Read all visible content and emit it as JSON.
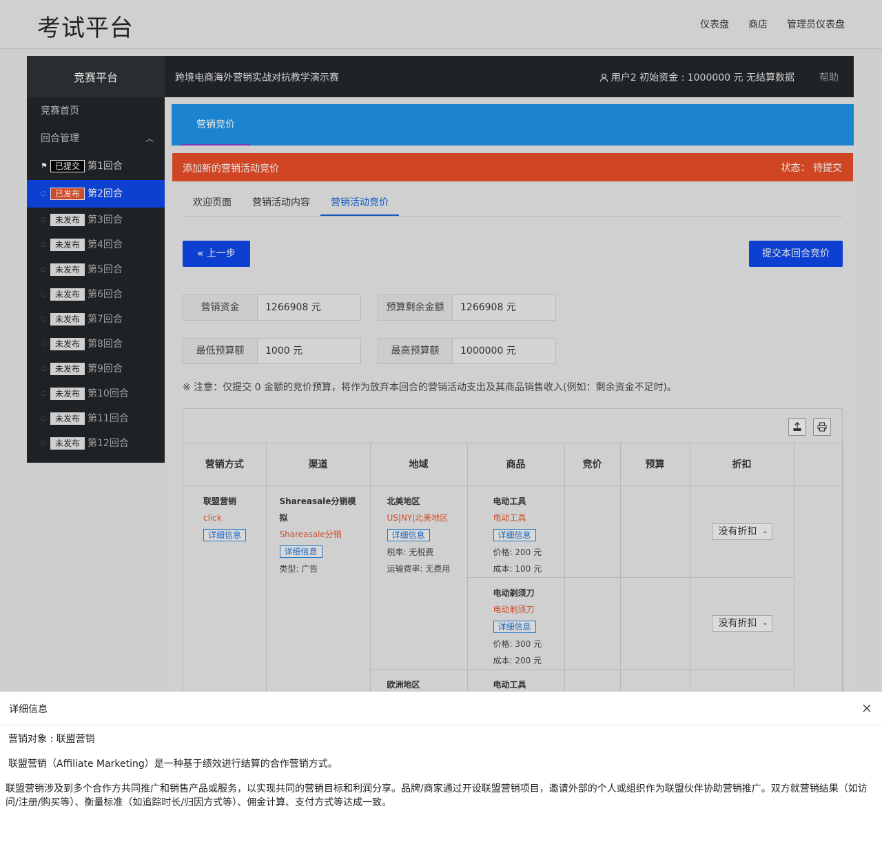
{
  "topnav": {
    "brand": "考试平台",
    "links": [
      "仪表盘",
      "商店",
      "管理员仪表盘"
    ]
  },
  "header": {
    "platform": "竞赛平台",
    "contest_title": "跨境电商海外营销实战对抗教学演示赛",
    "user_info": "用户2 初始资金 : 1000000 元 无结算数据",
    "help": "帮助"
  },
  "sidebar": {
    "home": "竞赛首页",
    "round_mgmt": "回合管理",
    "rounds": [
      {
        "status": "已提交",
        "name": "第1回合"
      },
      {
        "status": "已发布",
        "name": "第2回合"
      },
      {
        "status": "未发布",
        "name": "第3回合"
      },
      {
        "status": "未发布",
        "name": "第4回合"
      },
      {
        "status": "未发布",
        "name": "第5回合"
      },
      {
        "status": "未发布",
        "name": "第6回合"
      },
      {
        "status": "未发布",
        "name": "第7回合"
      },
      {
        "status": "未发布",
        "name": "第8回合"
      },
      {
        "status": "未发布",
        "name": "第9回合"
      },
      {
        "status": "未发布",
        "name": "第10回合"
      },
      {
        "status": "未发布",
        "name": "第11回合"
      },
      {
        "status": "未发布",
        "name": "第12回合"
      }
    ]
  },
  "tabbar": {
    "active": "营销竞价"
  },
  "panel": {
    "title": "添加新的营销活动竞价",
    "status_label": "状态：",
    "status_value": "待提交",
    "subtabs": [
      "欢迎页面",
      "营销活动内容",
      "营销活动竞价"
    ],
    "prev_button": "上一步",
    "submit_button": "提交本回合竞价",
    "fields": {
      "fund_label": "营销资金",
      "fund_value": "1266908 元",
      "remain_label": "预算剩余金额",
      "remain_value": "1266908 元",
      "min_label": "最低预算额",
      "min_value": "1000 元",
      "max_label": "最高预算额",
      "max_value": "1000000 元"
    },
    "note": "※ 注意：仅提交 0 金额的竞价预算，将作为放弃本回合的营销活动支出及其商品销售收入(例如：剩余资金不足时)。"
  },
  "table": {
    "headers": [
      "营销方式",
      "渠道",
      "地域",
      "商品",
      "竞价",
      "预算",
      "折扣"
    ],
    "method": {
      "name": "联盟营销",
      "sub": "click",
      "info": "详细信息"
    },
    "channel": {
      "name": "Shareasale分销模拟",
      "sub": "Shareasale分销",
      "info": "详细信息",
      "type": "类型: 广告"
    },
    "region1": {
      "name": "北美地区",
      "sub": "US|NY|北美地区",
      "info": "详细信息",
      "tax": "税率: 无税费",
      "ship": "运输费率: 无费用"
    },
    "region2": {
      "name": "欧洲地区"
    },
    "product1": {
      "name": "电动工具",
      "sub": "电动工具",
      "info": "详细信息",
      "price": "价格: 200 元",
      "cost": "成本: 100 元"
    },
    "product2": {
      "name": "电动剃须刀",
      "sub": "电动剃须刀",
      "info": "详细信息",
      "price": "价格: 300 元",
      "cost": "成本: 200 元"
    },
    "product3": {
      "name": "电动工具"
    },
    "discount": "没有折扣"
  },
  "modal": {
    "title": "详细信息",
    "line1": "营销对象 : 联盟营销",
    "line2": "联盟营销（Affiliate Marketing）是一种基于绩效进行结算的合作营销方式。",
    "line3": "联盟营销涉及到多个合作方共同推广和销售产品或服务，以实现共同的营销目标和利润分享。品牌/商家通过开设联盟营销项目，邀请外部的个人或组织作为联盟伙伴协助营销推广。双方就营销结果（如访问/注册/购买等）、衡量标准（如追踪时长/归因方式等）、佣金计算、支付方式等达成一致。"
  }
}
